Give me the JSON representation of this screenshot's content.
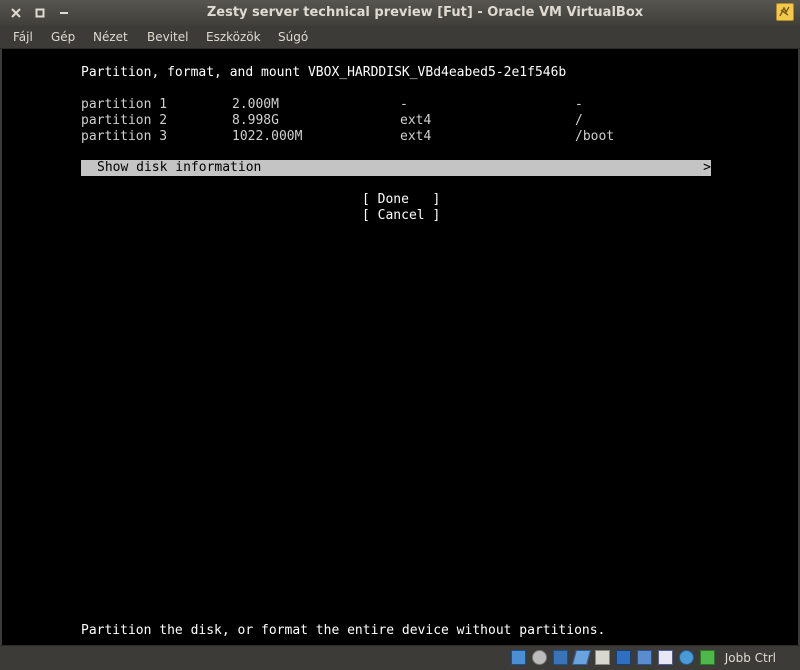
{
  "window": {
    "title": "Zesty server technical preview [Fut] - Oracle VM VirtualBox",
    "buttons": {
      "close": "✕",
      "maximize": "◻",
      "minimize": "—"
    }
  },
  "menubar": {
    "items": [
      "Fájl",
      "Gép",
      "Nézet",
      "Bevitel",
      "Eszközök",
      "Súgó"
    ]
  },
  "screen": {
    "heading": "Partition, format, and mount VBOX_HARDDISK_VBd4eabed5-2e1f546b",
    "partitions": [
      {
        "name": "partition 1",
        "size": "2.000M",
        "fs": "-",
        "mount": "-"
      },
      {
        "name": "partition 2",
        "size": "8.998G",
        "fs": "ext4",
        "mount": "/"
      },
      {
        "name": "partition 3",
        "size": "1022.000M",
        "fs": "ext4",
        "mount": "/boot"
      }
    ],
    "selected_option": "Show disk information",
    "selected_arrow": ">",
    "done_button": "[ Done   ]",
    "cancel_button": "[ Cancel ]",
    "footer": "Partition the disk, or format the entire device without partitions."
  },
  "statusbar": {
    "host_key": "Jobb Ctrl",
    "icons": [
      "hard-disk-icon",
      "optical-drive-icon",
      "network-icon",
      "usb-icon",
      "shared-folders-icon",
      "display-icon",
      "video-capture-icon",
      "virtualization-icon",
      "mouse-integration-icon",
      "keyboard-icon"
    ]
  }
}
